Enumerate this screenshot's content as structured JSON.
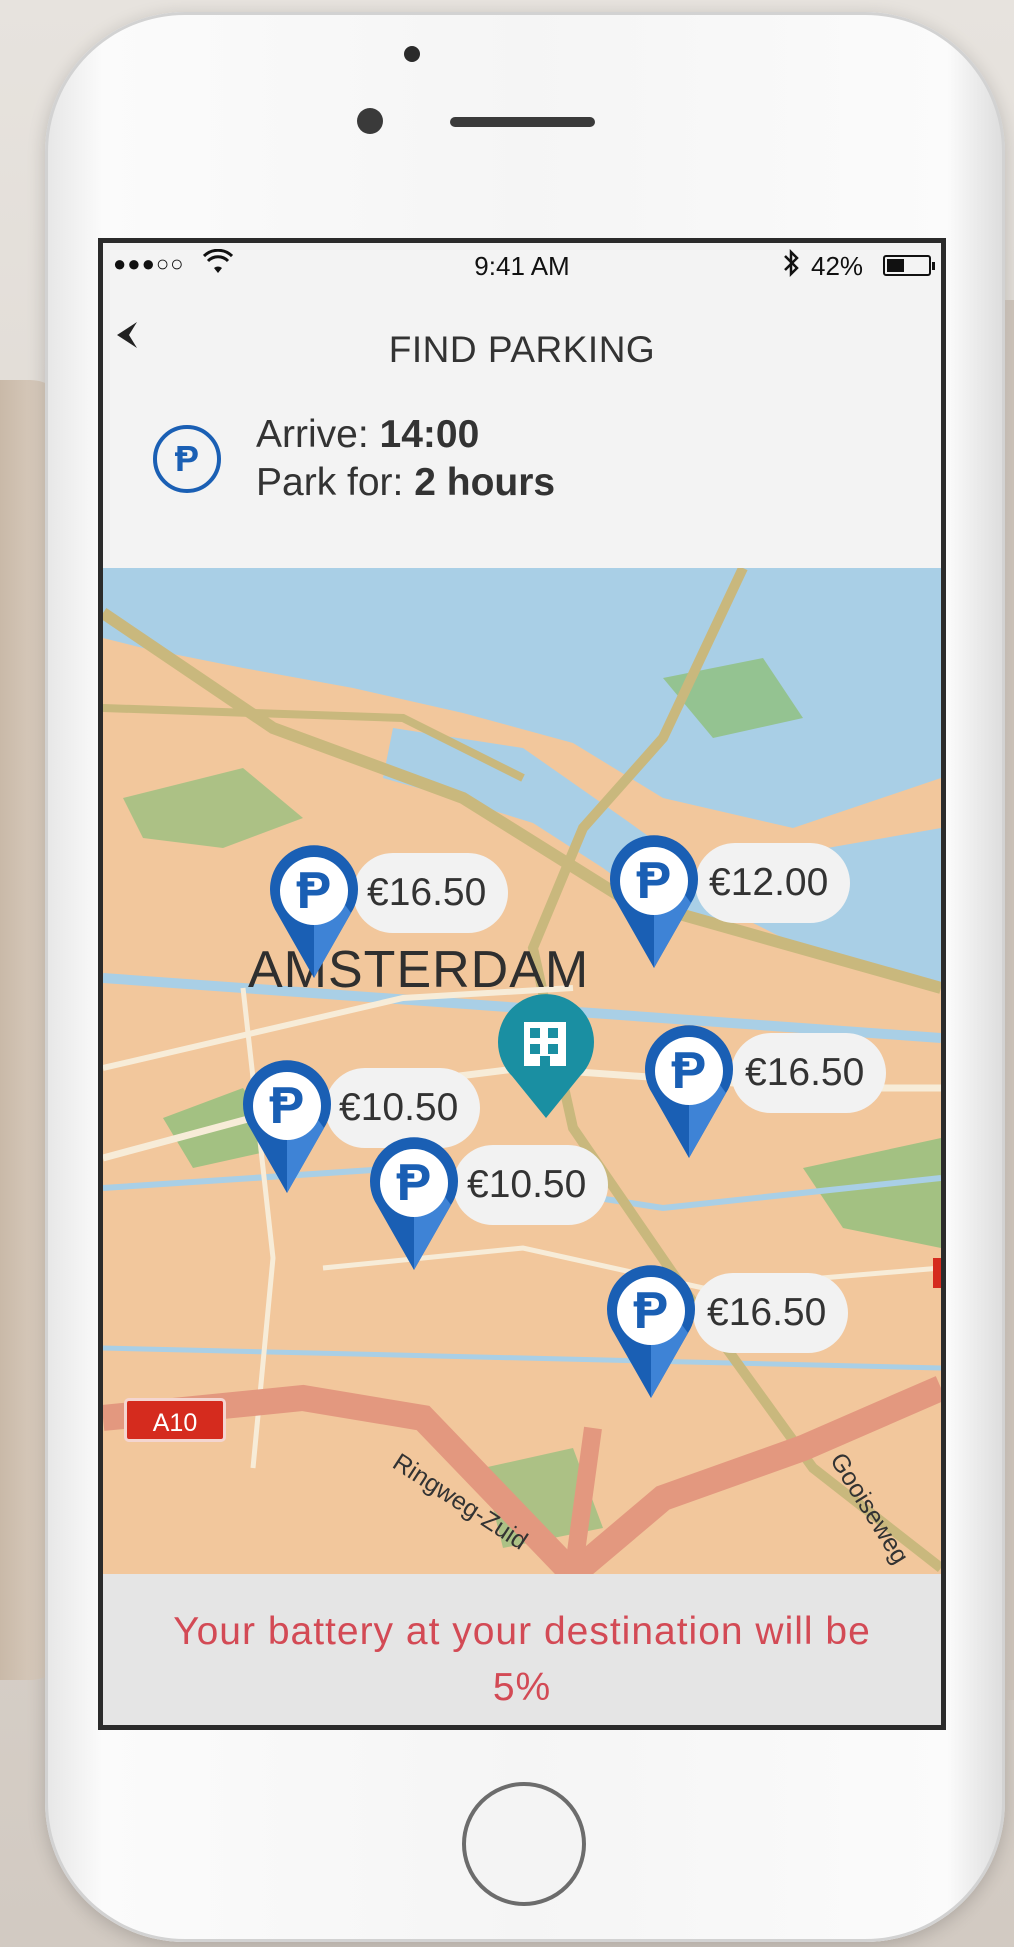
{
  "status_bar": {
    "signal": "●●●○○",
    "time": "9:41 AM",
    "battery_percent_text": "42%",
    "battery_level": 0.42
  },
  "nav": {
    "back_icon": "chevron-left-icon",
    "title": "FIND PARKING"
  },
  "info": {
    "icon": "parking-icon",
    "arrive_label": "Arrive:",
    "arrive_value": "14:00",
    "park_label": "Park for:",
    "park_value": "2 hours"
  },
  "map": {
    "city_label": "AMSTERDAM",
    "road_shield": "A10",
    "road_labels": [
      "Ringweg-Zuid",
      "Gooiseweg"
    ],
    "parking_spots": [
      {
        "price": "€16.50"
      },
      {
        "price": "€12.00"
      },
      {
        "price": "€10.50"
      },
      {
        "price": "€16.50"
      },
      {
        "price": "€10.50"
      },
      {
        "price": "€16.50"
      }
    ],
    "destination_icon": "building-icon",
    "colors": {
      "land": "#f2c79c",
      "water": "#a9cfe6",
      "park": "#8fbf7c",
      "pin_blue": "#1a5fb4",
      "destination_teal": "#1a8fa2"
    }
  },
  "footer": {
    "message": "Your battery at your destination will be 5%",
    "color": "#d34a55"
  }
}
